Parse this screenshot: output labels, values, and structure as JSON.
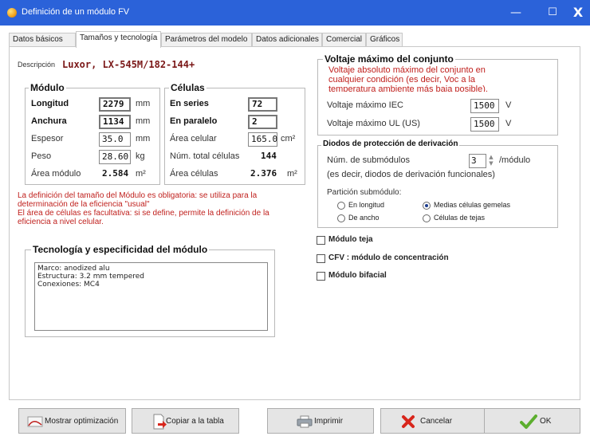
{
  "window": {
    "title": "Definición de un módulo FV",
    "minimize_glyph": "—",
    "maximize_glyph": "☐",
    "close_glyph": "X"
  },
  "tabs": [
    {
      "label": "Datos básicos"
    },
    {
      "label": "Tamaños y tecnología"
    },
    {
      "label": "Parámetros del modelo"
    },
    {
      "label": "Datos adicionales"
    },
    {
      "label": "Comercial"
    },
    {
      "label": "Gráficos"
    }
  ],
  "description": {
    "label": "Descripción",
    "value": "Luxor, LX-545M/182-144+"
  },
  "modulo": {
    "title": "Módulo",
    "longitud": {
      "label": "Longitud",
      "value": "2279",
      "unit": "mm"
    },
    "anchura": {
      "label": "Anchura",
      "value": "1134",
      "unit": "mm"
    },
    "espesor": {
      "label": "Espesor",
      "value": "35.0",
      "unit": "mm"
    },
    "peso": {
      "label": "Peso",
      "value": "28.60",
      "unit": "kg"
    },
    "area": {
      "label": "Área módulo",
      "value": "2.584",
      "unit": "m²"
    }
  },
  "celulas": {
    "title": "Células",
    "series": {
      "label": "En series",
      "value": "72"
    },
    "paralelo": {
      "label": "En paralelo",
      "value": "2"
    },
    "area_celular": {
      "label": "Área celular",
      "value": "165.0",
      "unit": "cm²"
    },
    "total": {
      "label": "Núm. total células",
      "value": "144"
    },
    "area_celulas": {
      "label": "Área células",
      "value": "2.376",
      "unit": "m²"
    }
  },
  "note": {
    "line1": "La definición del tamaño del Módulo es obligatoria: se utiliza para la",
    "line2": "determinación de la eficiencia \"usual\"",
    "line3": "El área de células es facultativa: si se define, permite la definición de la",
    "line4": "eficiencia a nivel celular."
  },
  "tecnologia": {
    "title": "Tecnología y especificidad del módulo",
    "lines": [
      "Marco: anodized alu",
      "Estructura: 3.2 mm tempered",
      "Conexiones: MC4"
    ]
  },
  "voltaje": {
    "title": "Voltaje máximo del conjunto",
    "note1": "Voltaje absoluto máximo del conjunto en",
    "note2": "cualquier condición (es decir, Voc a la",
    "note3": "temperatura ambiente más baja posible).",
    "iec": {
      "label": "Voltaje máximo IEC",
      "value": "1500",
      "unit": "V"
    },
    "ul": {
      "label": "Voltaje máximo UL (US)",
      "value": "1500",
      "unit": "V"
    }
  },
  "diodos": {
    "title": "Diodos de protección de derivación",
    "submodulos": {
      "label": "Núm. de submódulos",
      "value": "3",
      "unit": "/módulo"
    },
    "explain": "(es decir, diodos de derivación funcionales)",
    "particion_label": "Partición submódulo:",
    "options": [
      {
        "label": "En longitud",
        "selected": false
      },
      {
        "label": "Medias células gemelas",
        "selected": true
      },
      {
        "label": "De ancho",
        "selected": false
      },
      {
        "label": "Células de tejas",
        "selected": false
      }
    ]
  },
  "checks": [
    {
      "label": "Módulo teja",
      "checked": false
    },
    {
      "label": "CFV : módulo de concentración",
      "checked": false
    },
    {
      "label": "Módulo bifacial",
      "checked": false
    }
  ],
  "buttons": {
    "mostrar": "Mostrar optimización",
    "copiar": "Copiar a la tabla",
    "imprimir": "Imprimir",
    "cancelar": "Cancelar",
    "ok": "OK"
  },
  "colors": {
    "titlebar": "#2b62d9",
    "accent_red": "#c0211e",
    "ok_green": "#5cae2e"
  }
}
